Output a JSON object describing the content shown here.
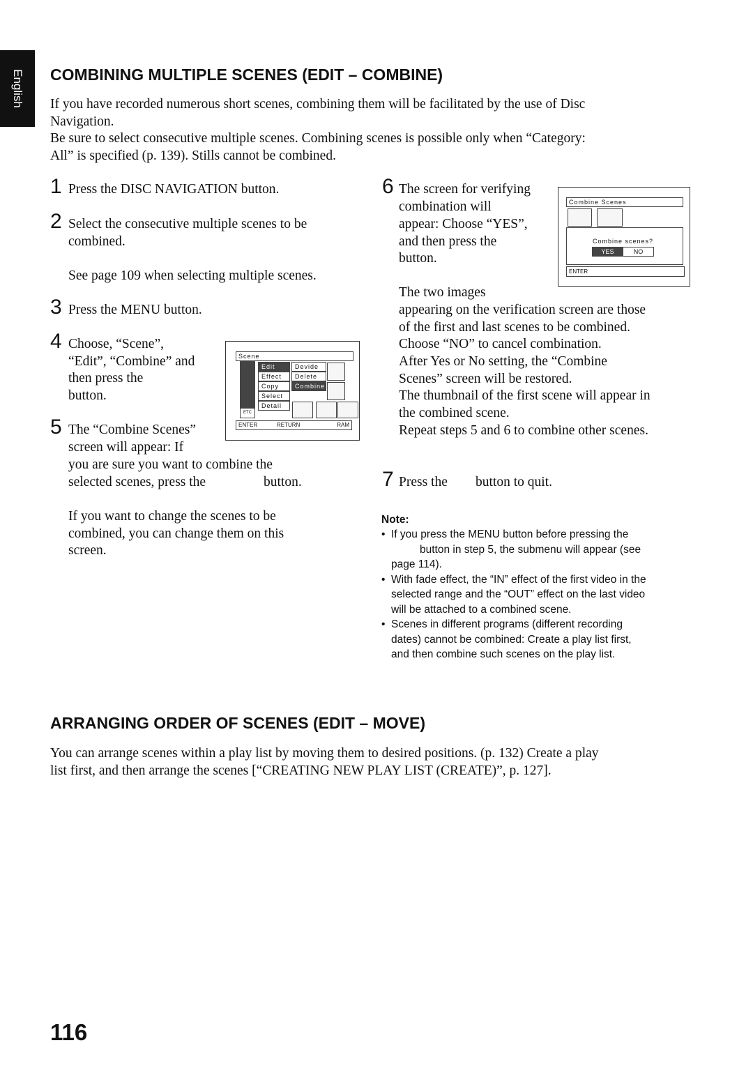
{
  "side_tab": "English",
  "section1": {
    "title": "COMBINING MULTIPLE SCENES (EDIT – COMBINE)",
    "intro": [
      "If you have recorded numerous short scenes, combining them will be facilitated by the use of Disc",
      "Navigation.",
      "Be sure to select consecutive multiple scenes. Combining scenes is possible only when “Category:",
      "All” is specified (p. 139). Stills cannot be combined."
    ],
    "steps": [
      {
        "n": "1",
        "lines": [
          "Press the DISC NAVIGATION button."
        ]
      },
      {
        "n": "2",
        "lines": [
          "Select the consecutive multiple scenes to be",
          "combined.",
          "See page 109 when selecting multiple scenes."
        ]
      },
      {
        "n": "3",
        "lines": [
          "Press the MENU button."
        ]
      },
      {
        "n": "4",
        "lines": [
          "Choose, “Scene”,",
          "“Edit”, “Combine” and",
          "then press the",
          "button."
        ]
      },
      {
        "n": "5",
        "lines": [
          "The “Combine Scenes”",
          "screen will appear: If",
          "you are sure you want to combine the",
          "selected scenes, press the",
          "button.",
          "If you want to change the scenes to be",
          "combined, you can change them on this",
          "screen."
        ]
      },
      {
        "n": "6",
        "lines": [
          "The screen for verifying",
          "combination will",
          "appear: Choose “YES”,",
          "and then press the",
          "button.",
          "The two images",
          "appearing on the verification screen are those",
          "of the first and last scenes to be combined.",
          "Choose “NO” to cancel combination.",
          "After Yes or No setting, the “Combine",
          "Scenes” screen will be restored.",
          "The thumbnail of the first scene will appear in",
          "the combined scene.",
          "Repeat steps 5 and 6 to combine other scenes."
        ]
      },
      {
        "n": "7",
        "lines": [
          "Press the",
          "button to quit."
        ]
      }
    ],
    "menu_screen": {
      "header": "Scene",
      "menu": [
        "Edit",
        "Effect",
        "Copy",
        "Select",
        "Detail"
      ],
      "submenu": [
        "Devide",
        "Delete",
        "Combine"
      ],
      "etc": "ETC",
      "enter": "ENTER",
      "return": "RETURN",
      "ram": "RAM"
    },
    "confirm_screen": {
      "header": "Combine Scenes",
      "question": "Combine scenes?",
      "yes": "YES",
      "no": "NO",
      "enter": "ENTER"
    },
    "note": {
      "label": "Note:",
      "bullets": [
        [
          "If you press the MENU button before pressing the",
          "button in step 5, the submenu will appear (see",
          "page 114)."
        ],
        [
          "With fade effect, the “IN” effect of the first video in the",
          "selected range and the “OUT” effect on the last video",
          "will be attached to a combined scene."
        ],
        [
          "Scenes in different programs (different recording",
          "dates) cannot be combined: Create a play list first,",
          "and then combine such scenes on the play list."
        ]
      ]
    }
  },
  "section2": {
    "title": "ARRANGING ORDER OF SCENES (EDIT – MOVE)",
    "body": [
      "You can arrange scenes within a play list by moving them to desired positions. (p. 132) Create a play",
      "list first, and then arrange the scenes [“CREATING NEW PLAY LIST (CREATE)”, p. 127]."
    ]
  },
  "page_number": "116"
}
